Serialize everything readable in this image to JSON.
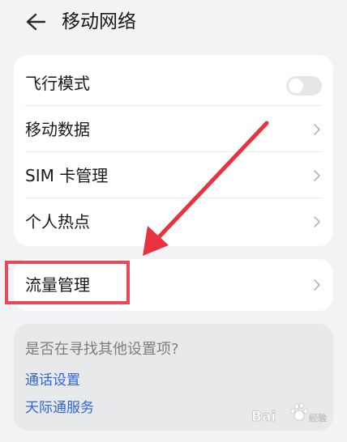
{
  "header": {
    "title": "移动网络",
    "back_icon": "arrow-left-icon"
  },
  "settings_list": {
    "items": [
      {
        "label": "飞行模式",
        "control": "toggle",
        "toggle_on": false
      },
      {
        "label": "移动数据",
        "control": "chevron"
      },
      {
        "label": "SIM 卡管理",
        "control": "chevron"
      },
      {
        "label": "个人热点",
        "control": "chevron"
      }
    ]
  },
  "traffic": {
    "label": "流量管理",
    "control": "chevron"
  },
  "suggestions": {
    "title": "是否在寻找其他设置项?",
    "links": [
      "通话设置",
      "天际通服务"
    ]
  },
  "annotation": {
    "arrow_color": "#e8323f",
    "highlight_color": "#e8485a"
  },
  "watermark": {
    "text": "Bai 经验",
    "kind": "baidu-jingyan-logo"
  }
}
